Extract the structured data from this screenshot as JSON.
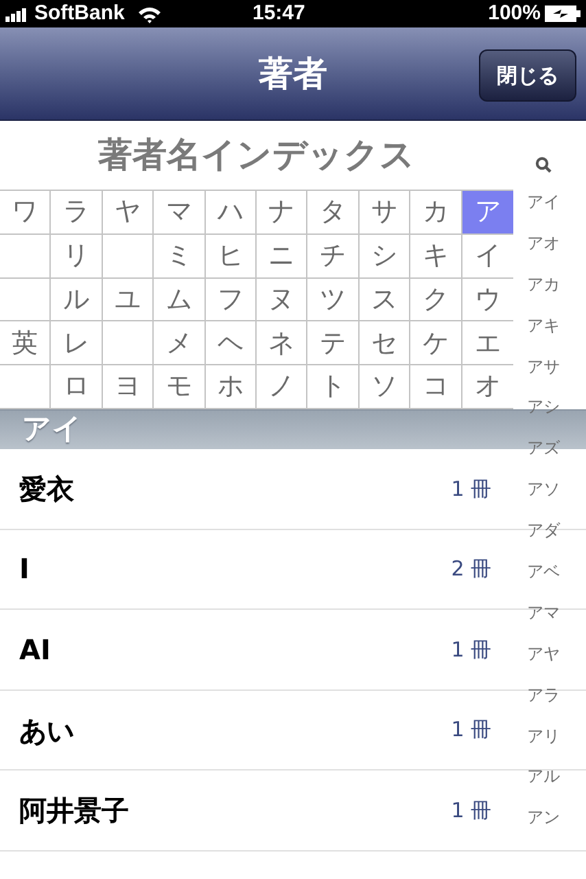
{
  "status_bar": {
    "carrier": "SoftBank",
    "time": "15:47",
    "battery": "100%"
  },
  "nav_bar": {
    "title": "著者",
    "close_button": "閉じる"
  },
  "index_title": "著者名インデックス",
  "kana_grid": [
    [
      {
        "label": "ワ",
        "selected": false
      },
      {
        "label": "ラ",
        "selected": false
      },
      {
        "label": "ヤ",
        "selected": false
      },
      {
        "label": "マ",
        "selected": false
      },
      {
        "label": "ハ",
        "selected": false
      },
      {
        "label": "ナ",
        "selected": false
      },
      {
        "label": "タ",
        "selected": false
      },
      {
        "label": "サ",
        "selected": false
      },
      {
        "label": "カ",
        "selected": false
      },
      {
        "label": "ア",
        "selected": true
      }
    ],
    [
      {
        "selected": false
      },
      {
        "label": "リ",
        "selected": false
      },
      {
        "selected": false
      },
      {
        "label": "ミ",
        "selected": false
      },
      {
        "label": "ヒ",
        "selected": false
      },
      {
        "label": "ニ",
        "selected": false
      },
      {
        "label": "チ",
        "selected": false
      },
      {
        "label": "シ",
        "selected": false
      },
      {
        "label": "キ",
        "selected": false
      },
      {
        "label": "イ",
        "selected": false
      }
    ],
    [
      {
        "selected": false
      },
      {
        "label": "ル",
        "selected": false
      },
      {
        "label": "ユ",
        "selected": false
      },
      {
        "label": "ム",
        "selected": false
      },
      {
        "label": "フ",
        "selected": false
      },
      {
        "label": "ヌ",
        "selected": false
      },
      {
        "label": "ツ",
        "selected": false
      },
      {
        "label": "ス",
        "selected": false
      },
      {
        "label": "ク",
        "selected": false
      },
      {
        "label": "ウ",
        "selected": false
      }
    ],
    [
      {
        "label": "英",
        "selected": false
      },
      {
        "label": "レ",
        "selected": false
      },
      {
        "selected": false
      },
      {
        "label": "メ",
        "selected": false
      },
      {
        "label": "ヘ",
        "selected": false
      },
      {
        "label": "ネ",
        "selected": false
      },
      {
        "label": "テ",
        "selected": false
      },
      {
        "label": "セ",
        "selected": false
      },
      {
        "label": "ケ",
        "selected": false
      },
      {
        "label": "エ",
        "selected": false
      }
    ],
    [
      {
        "selected": false
      },
      {
        "label": "ロ",
        "selected": false
      },
      {
        "label": "ヨ",
        "selected": false
      },
      {
        "label": "モ",
        "selected": false
      },
      {
        "label": "ホ",
        "selected": false
      },
      {
        "label": "ノ",
        "selected": false
      },
      {
        "label": "ト",
        "selected": false
      },
      {
        "label": "ソ",
        "selected": false
      },
      {
        "label": "コ",
        "selected": false
      },
      {
        "label": "オ",
        "selected": false
      }
    ]
  ],
  "section_header": "アイ",
  "authors": [
    {
      "name": "愛衣",
      "count": "1 冊"
    },
    {
      "name": "I",
      "count": "2 冊"
    },
    {
      "name": "AI",
      "count": "1 冊"
    },
    {
      "name": "あい",
      "count": "1 冊"
    },
    {
      "name": "阿井景子",
      "count": "1 冊"
    }
  ],
  "side_index": [
    "アイ",
    "アオ",
    "アカ",
    "アキ",
    "アサ",
    "アシ",
    "アズ",
    "アソ",
    "アダ",
    "アベ",
    "アマ",
    "アヤ",
    "アラ",
    "アリ",
    "アル",
    "アン"
  ]
}
